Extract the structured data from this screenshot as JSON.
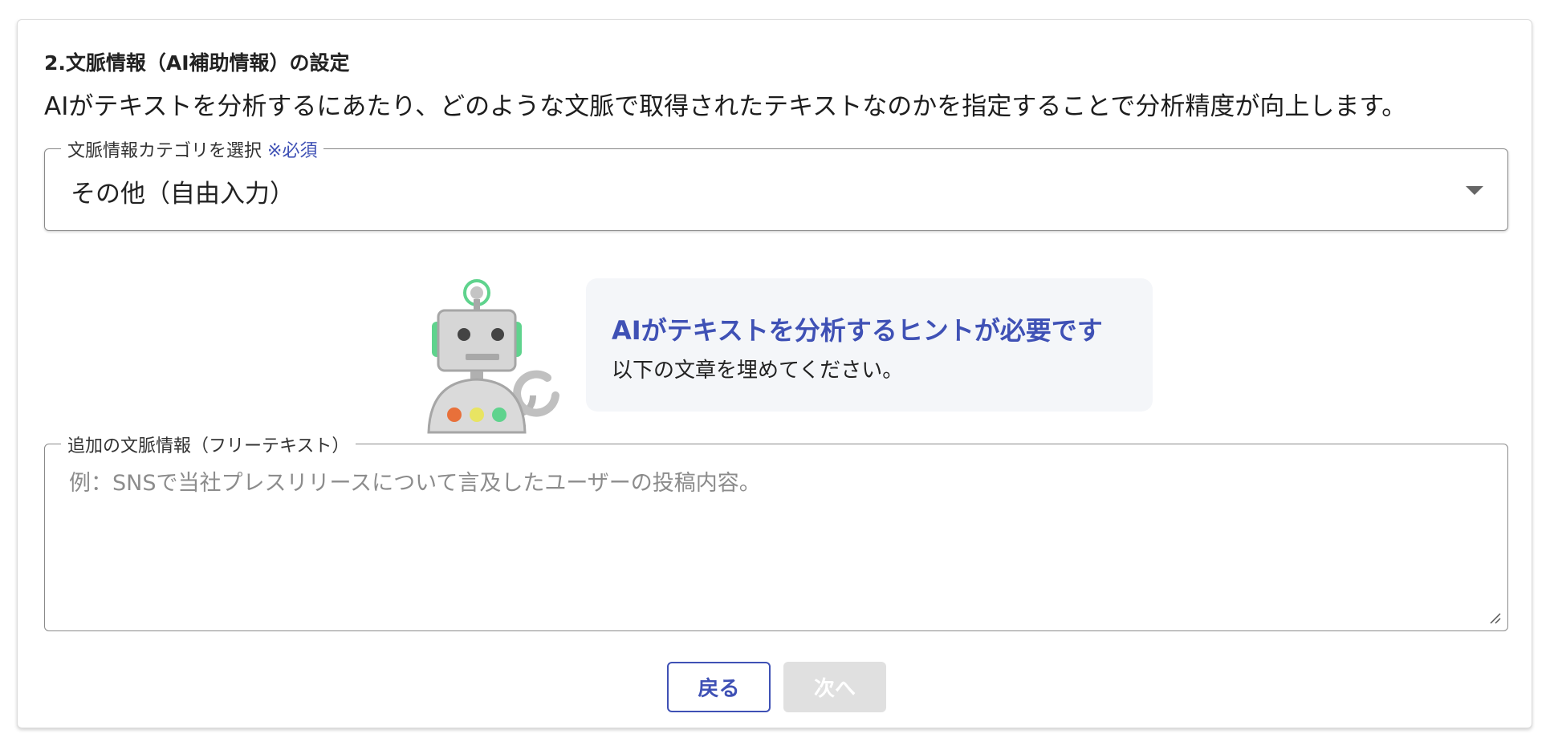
{
  "section": {
    "title": "2.文脈情報（AI補助情報）の設定",
    "description": "AIがテキストを分析するにあたり、どのような文脈で取得されたテキストなのかを指定することで分析精度が向上します。"
  },
  "category_select": {
    "label": "文脈情報カテゴリを選択",
    "required_mark": "※必須",
    "selected_value": "その他（自由入力）"
  },
  "hint": {
    "title": "AIがテキストを分析するヒントが必要です",
    "subtitle": "以下の文章を埋めてください。"
  },
  "additional_context": {
    "label": "追加の文脈情報（フリーテキスト）",
    "value": "",
    "placeholder": "例：SNSで当社プレスリリースについて言及したユーザーの投稿内容。"
  },
  "buttons": {
    "back_label": "戻る",
    "next_label": "次へ",
    "next_disabled": true
  },
  "colors": {
    "accent": "#3f51b5",
    "hint_background": "#f4f6f9",
    "disabled_button": "#e0e0e0",
    "robot_antenna": "#5fd38d",
    "robot_light_red": "#e8703a",
    "robot_light_yellow": "#e8e462",
    "robot_light_green": "#5fd38d"
  },
  "icons": {
    "robot": "robot-illustration-icon",
    "dropdown": "chevron-down-icon",
    "resize": "resize-handle-icon"
  }
}
